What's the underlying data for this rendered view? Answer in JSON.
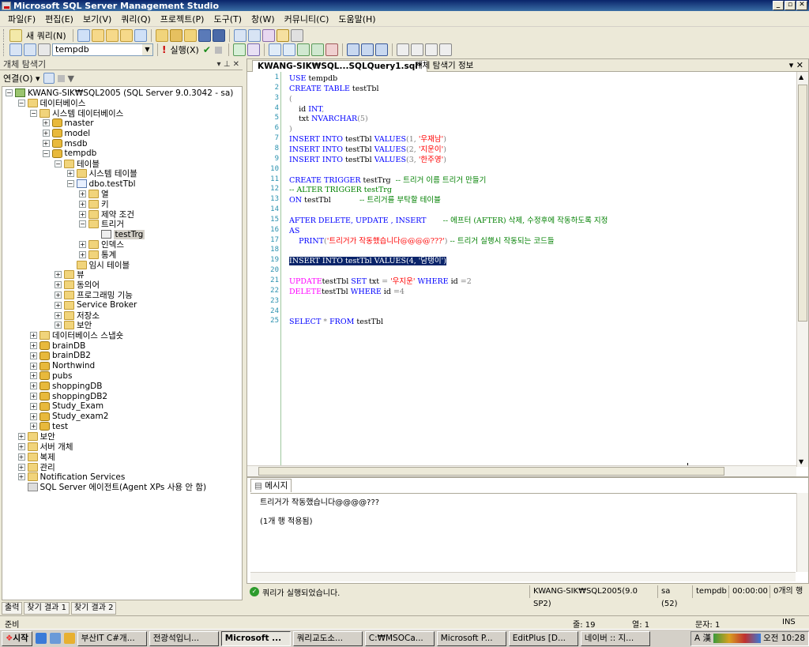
{
  "window": {
    "title": "Microsoft SQL Server Management Studio",
    "buttons": [
      "_",
      "▫",
      "✕"
    ]
  },
  "menu": [
    "파일(F)",
    "편집(E)",
    "보기(V)",
    "쿼리(Q)",
    "프로젝트(P)",
    "도구(T)",
    "창(W)",
    "커뮤니티(C)",
    "도움말(H)"
  ],
  "toolbar1": {
    "new_query": "새 쿼리(N)"
  },
  "toolbar2": {
    "database": "tempdb",
    "execute": "실행(X)"
  },
  "explorer": {
    "title": "개체 탐색기",
    "title_controls": "▾ ⊥ ✕",
    "connect": "연결(O) ▾",
    "nodes": [
      {
        "label": "KWANG-SIK₩SQL2005 (SQL Server 9.0.3042 - sa)",
        "icon": "server",
        "pm": "−",
        "depth": 0
      },
      {
        "label": "데이터베이스",
        "icon": "folder",
        "pm": "−",
        "depth": 1
      },
      {
        "label": "시스템 데이터베이스",
        "icon": "folder",
        "pm": "−",
        "depth": 2
      },
      {
        "label": "master",
        "icon": "db",
        "pm": "+",
        "depth": 3
      },
      {
        "label": "model",
        "icon": "db",
        "pm": "+",
        "depth": 3
      },
      {
        "label": "msdb",
        "icon": "db",
        "pm": "+",
        "depth": 3
      },
      {
        "label": "tempdb",
        "icon": "db",
        "pm": "−",
        "depth": 3
      },
      {
        "label": "테이블",
        "icon": "folder",
        "pm": "−",
        "depth": 4
      },
      {
        "label": "시스템 테이블",
        "icon": "folder",
        "pm": "+",
        "depth": 5
      },
      {
        "label": "dbo.testTbl",
        "icon": "tbl",
        "pm": "−",
        "depth": 5
      },
      {
        "label": "열",
        "icon": "folder",
        "pm": "+",
        "depth": 6
      },
      {
        "label": "키",
        "icon": "folder",
        "pm": "+",
        "depth": 6
      },
      {
        "label": "제약 조건",
        "icon": "folder",
        "pm": "+",
        "depth": 6
      },
      {
        "label": "트리거",
        "icon": "folder",
        "pm": "−",
        "depth": 6
      },
      {
        "label": "testTrg",
        "icon": "trg",
        "pm": "",
        "depth": 7,
        "selected": true
      },
      {
        "label": "인덱스",
        "icon": "folder",
        "pm": "+",
        "depth": 6
      },
      {
        "label": "통계",
        "icon": "folder",
        "pm": "+",
        "depth": 6
      },
      {
        "label": "임시 테이블",
        "icon": "folder",
        "pm": "",
        "depth": 5
      },
      {
        "label": "뷰",
        "icon": "folder",
        "pm": "+",
        "depth": 4
      },
      {
        "label": "동의어",
        "icon": "folder",
        "pm": "+",
        "depth": 4
      },
      {
        "label": "프로그래밍 기능",
        "icon": "folder",
        "pm": "+",
        "depth": 4
      },
      {
        "label": "Service Broker",
        "icon": "folder",
        "pm": "+",
        "depth": 4
      },
      {
        "label": "저장소",
        "icon": "folder",
        "pm": "+",
        "depth": 4
      },
      {
        "label": "보안",
        "icon": "folder",
        "pm": "+",
        "depth": 4
      },
      {
        "label": "데이터베이스 스냅숏",
        "icon": "folder",
        "pm": "+",
        "depth": 2
      },
      {
        "label": "brainDB",
        "icon": "db",
        "pm": "+",
        "depth": 2
      },
      {
        "label": "brainDB2",
        "icon": "db",
        "pm": "+",
        "depth": 2
      },
      {
        "label": "Northwind",
        "icon": "db",
        "pm": "+",
        "depth": 2
      },
      {
        "label": "pubs",
        "icon": "db",
        "pm": "+",
        "depth": 2
      },
      {
        "label": "shoppingDB",
        "icon": "db",
        "pm": "+",
        "depth": 2
      },
      {
        "label": "shoppingDB2",
        "icon": "db",
        "pm": "+",
        "depth": 2
      },
      {
        "label": "Study_Exam",
        "icon": "db",
        "pm": "+",
        "depth": 2
      },
      {
        "label": "Study_exam2",
        "icon": "db",
        "pm": "+",
        "depth": 2
      },
      {
        "label": "test",
        "icon": "db",
        "pm": "+",
        "depth": 2
      },
      {
        "label": "보안",
        "icon": "folder",
        "pm": "+",
        "depth": 1
      },
      {
        "label": "서버 개체",
        "icon": "folder",
        "pm": "+",
        "depth": 1
      },
      {
        "label": "복제",
        "icon": "folder",
        "pm": "+",
        "depth": 1
      },
      {
        "label": "관리",
        "icon": "folder",
        "pm": "+",
        "depth": 1
      },
      {
        "label": "Notification Services",
        "icon": "folder",
        "pm": "+",
        "depth": 1
      },
      {
        "label": "SQL Server 에이전트(Agent XPs 사용 안 함)",
        "icon": "agent",
        "pm": "",
        "depth": 1
      }
    ]
  },
  "editor": {
    "tabs": [
      "KWANG-SIK₩SQL...SQLQuery1.sql*",
      "개체 탐색기 정보"
    ],
    "close": "▾ ✕",
    "lines": [
      [
        [
          "kw",
          "USE"
        ],
        [
          "",
          "tempdb"
        ]
      ],
      [
        [
          "kw",
          "CREATE TABLE"
        ],
        [
          "",
          "testTbl"
        ]
      ],
      [
        [
          "gray",
          "("
        ]
      ],
      [
        [
          "",
          "    id "
        ],
        [
          "kw",
          "INT"
        ],
        [
          "gray",
          ","
        ]
      ],
      [
        [
          "",
          "    txt "
        ],
        [
          "kw",
          "NVARCHAR"
        ],
        [
          "gray",
          "(5)"
        ]
      ],
      [
        [
          "gray",
          ")"
        ]
      ],
      [
        [
          "kw",
          "INSERT INTO"
        ],
        [
          "",
          "testTbl "
        ],
        [
          "kw",
          "VALUES"
        ],
        [
          "gray",
          "(1, "
        ],
        [
          "str",
          "'우재남'"
        ],
        [
          "gray",
          ")"
        ]
      ],
      [
        [
          "kw",
          "INSERT INTO"
        ],
        [
          "",
          "testTbl "
        ],
        [
          "kw",
          "VALUES"
        ],
        [
          "gray",
          "(2, "
        ],
        [
          "str",
          "'지운이'"
        ],
        [
          "gray",
          ")"
        ]
      ],
      [
        [
          "kw",
          "INSERT INTO"
        ],
        [
          "",
          "testTbl "
        ],
        [
          "kw",
          "VALUES"
        ],
        [
          "gray",
          "(3, "
        ],
        [
          "str",
          "'한주영'"
        ],
        [
          "gray",
          ")"
        ]
      ],
      [],
      [
        [
          "kw",
          "CREATE TRIGGER"
        ],
        [
          "",
          "testTrg  "
        ],
        [
          "cm",
          "-- 트리거 이름 트리거 만들기"
        ]
      ],
      [
        [
          "cm",
          "-- ALTER TRIGGER testTrg"
        ]
      ],
      [
        [
          "kw",
          "ON"
        ],
        [
          "",
          "testTbl            "
        ],
        [
          "cm",
          "-- 트리거를 부탁할 테이블"
        ]
      ],
      [],
      [
        [
          "kw",
          "AFTER DELETE, UPDATE , INSERT"
        ],
        [
          "",
          "       "
        ],
        [
          "cm",
          "-- 에프터 (AFTER) 삭제, 수정후에 작동하도록 지정"
        ]
      ],
      [
        [
          "kw",
          "AS"
        ]
      ],
      [
        [
          "",
          "    "
        ],
        [
          "kw",
          "PRINT"
        ],
        [
          "gray",
          "("
        ],
        [
          "str",
          "'트리거가 작동했습니다@@@@???'"
        ],
        [
          "gray",
          ")"
        ],
        [
          "cm",
          " -- 트리거 실행시 작동되는 코드들"
        ]
      ],
      [],
      [
        [
          "hl",
          "INSERT INTO testTbl VALUES(4, '담탱이')"
        ]
      ],
      [],
      [
        [
          "pink",
          "UPDATE"
        ],
        [
          "",
          "testTbl "
        ],
        [
          "kw",
          "SET"
        ],
        [
          "",
          "txt "
        ],
        [
          "gray",
          "= "
        ],
        [
          "str",
          "'우지운'"
        ],
        [
          "kw",
          " WHERE"
        ],
        [
          "",
          "id "
        ],
        [
          "gray",
          "=2"
        ]
      ],
      [
        [
          "pink",
          "DELETE"
        ],
        [
          "",
          "testTbl "
        ],
        [
          "kw",
          "WHERE"
        ],
        [
          "",
          "id "
        ],
        [
          "gray",
          "=4"
        ]
      ],
      [],
      [],
      [
        [
          "kw",
          "SELECT"
        ],
        [
          "gray",
          " * "
        ],
        [
          "kw",
          "FROM"
        ],
        [
          "",
          "testTbl"
        ]
      ]
    ]
  },
  "results": {
    "tab": "메시지",
    "lines": [
      "트리거가 작동했습니다@@@@???",
      "(1개 행 적용됨)"
    ]
  },
  "query_status": {
    "message": "쿼리가 실행되었습니다.",
    "server": "KWANG-SIK₩SQL2005(9.0 SP2)",
    "user": "sa (52)",
    "db": "tempdb",
    "time": "00:00:00",
    "rows": "0개의 행"
  },
  "bottom_tabs": [
    "출력",
    "찾기 결과 1",
    "찾기 결과 2"
  ],
  "status": {
    "ready": "준비",
    "line": "줄: 19",
    "col": "열: 1",
    "char": "문자: 1",
    "ins": "INS"
  },
  "taskbar": {
    "start": "시작",
    "tasks": [
      "부산IT C#개...",
      "전광석입니...",
      "Microsoft ...",
      "쿼리교도소...",
      "C:₩MSOCa...",
      "Microsoft P...",
      "EditPlus [D...",
      "네이버 :: 지..."
    ],
    "active_task": 2,
    "ime": "A 漢",
    "clock": "오전 10:28"
  }
}
